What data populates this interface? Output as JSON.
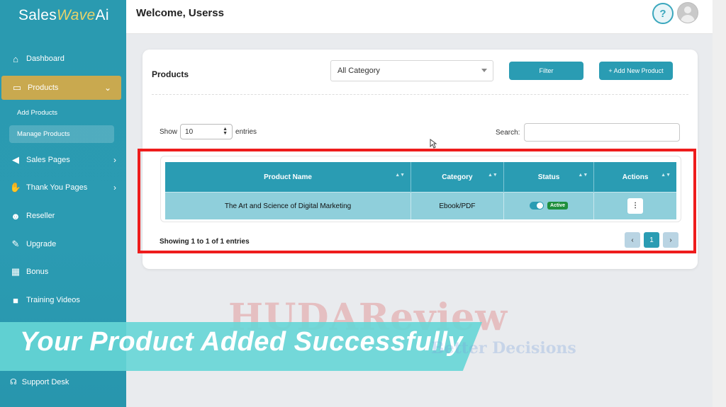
{
  "app": {
    "logo_text_1": "Sales",
    "logo_text_2": "Wave",
    "logo_text_3": "Ai",
    "welcome": "Welcome, Userss",
    "help_icon": "?"
  },
  "sidebar": {
    "items": [
      {
        "label": "Dashboard",
        "icon": "home-icon"
      },
      {
        "label": "Products",
        "icon": "store-icon",
        "chevron": "⌄"
      },
      {
        "label": "Sales Pages",
        "icon": "megaphone-icon",
        "chevron": "›"
      },
      {
        "label": "Thank You Pages",
        "icon": "handshake-icon",
        "chevron": "›"
      },
      {
        "label": "Reseller",
        "icon": "user-gear-icon"
      },
      {
        "label": "Upgrade",
        "icon": "wrench-icon"
      },
      {
        "label": "Bonus",
        "icon": "gift-icon"
      },
      {
        "label": "Training Videos",
        "icon": "video-icon"
      },
      {
        "label": "Support Desk",
        "icon": "headset-icon"
      }
    ],
    "sub_items": [
      {
        "label": "Add Products"
      },
      {
        "label": "Manage Products"
      }
    ]
  },
  "products_card": {
    "title": "Products",
    "category_value": "All Category",
    "filter_label": "Filter",
    "add_label": "+ Add New Product",
    "show_label": "Show",
    "entries_value": "10",
    "entries_label": "entries",
    "search_label": "Search:",
    "search_value": "",
    "columns": [
      "Product Name",
      "Category",
      "Status",
      "Actions"
    ],
    "rows": [
      {
        "name": "The Art and Science of Digital Marketing",
        "category": "Ebook/PDF",
        "status": "Active",
        "action": "⋮"
      }
    ],
    "showing_text": "Showing 1 to 1 of 1 entries",
    "pagination": {
      "prev": "‹",
      "page": "1",
      "next": "›"
    }
  },
  "overlay": {
    "banner_text": "Your Product Added Successfully",
    "watermark_1": "HUDAReview",
    "watermark_2": "Better Decisions"
  },
  "colors": {
    "primary": "#2a9cb3",
    "active_nav": "#c9a94f",
    "highlight_border": "#ee1c1c",
    "status_badge": "#1f8f3e",
    "banner": "#66d6d6"
  }
}
